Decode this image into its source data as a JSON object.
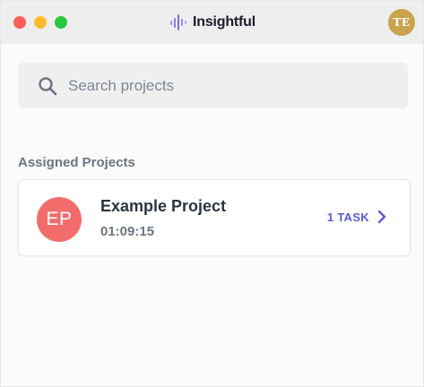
{
  "window": {
    "brand_name": "Insightful",
    "user_initials": "TE",
    "colors": {
      "close": "#fe5f57",
      "minimize": "#febc2e",
      "maximize": "#28c840",
      "avatar": "#c9a24c",
      "accent": "#5a5bd6"
    }
  },
  "search": {
    "placeholder": "Search projects",
    "value": "",
    "icon": "search-icon"
  },
  "assigned": {
    "title": "Assigned Projects",
    "projects": [
      {
        "initials": "EP",
        "name": "Example Project",
        "time": "01:09:15",
        "task_count": "1 TASK",
        "avatar_color": "#f36c6c",
        "icon": "chevron-right-icon"
      }
    ]
  }
}
